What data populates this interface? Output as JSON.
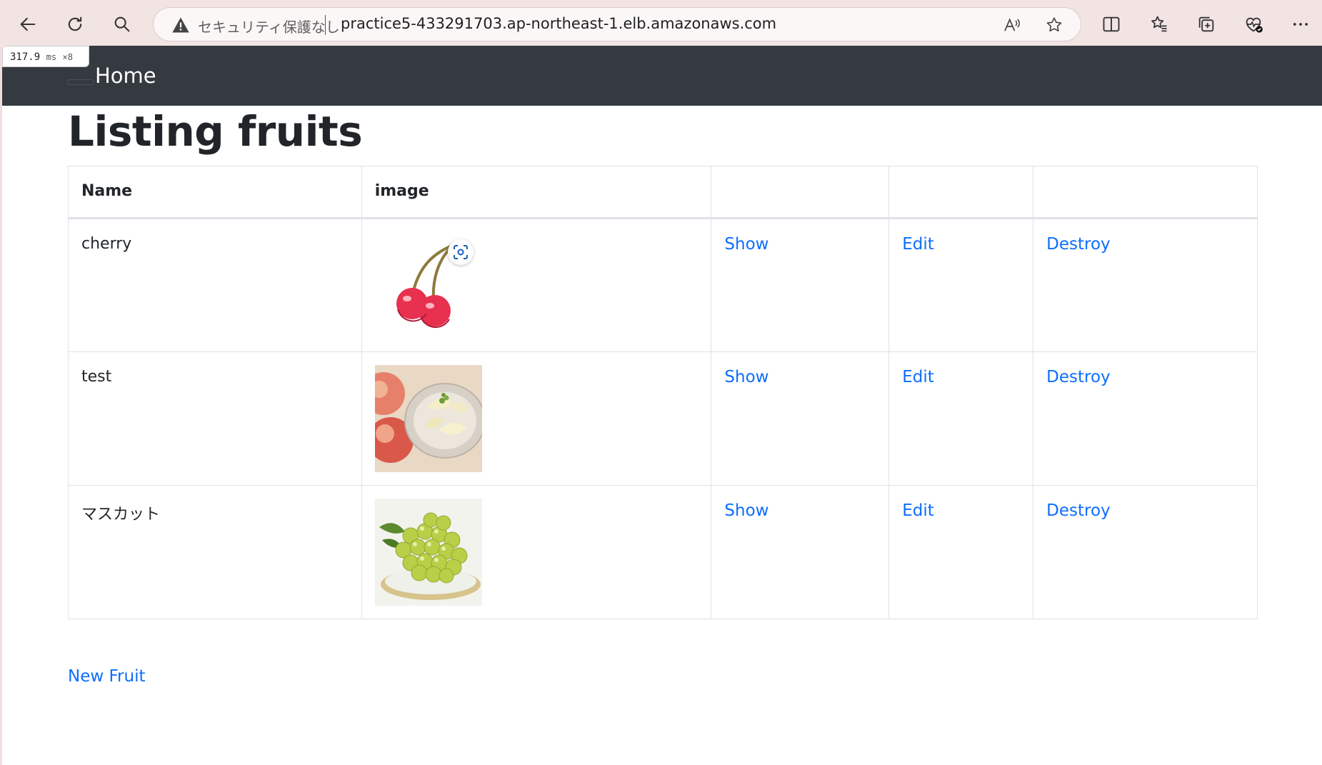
{
  "browser": {
    "security_label": "セキュリティ保護なし",
    "url": "practice5-433291703.ap-northeast-1.elb.amazonaws.com"
  },
  "perf_badge": {
    "time": "317.9",
    "unit": "ms",
    "multiplier": "×8"
  },
  "navbar": {
    "home_label": "Home"
  },
  "page": {
    "title": "Listing fruits",
    "new_link": "New Fruit"
  },
  "table": {
    "headers": [
      "Name",
      "image",
      "",
      "",
      ""
    ],
    "rows": [
      {
        "name": "cherry",
        "image": "cherry-illustration",
        "show": "Show",
        "edit": "Edit",
        "destroy": "Destroy"
      },
      {
        "name": "test",
        "image": "peach-photo",
        "show": "Show",
        "edit": "Edit",
        "destroy": "Destroy"
      },
      {
        "name": "マスカット",
        "image": "muscat-grapes-photo",
        "show": "Show",
        "edit": "Edit",
        "destroy": "Destroy"
      }
    ]
  },
  "colors": {
    "navbar_bg": "#343a40",
    "link": "#0d6efd",
    "text": "#212529"
  }
}
